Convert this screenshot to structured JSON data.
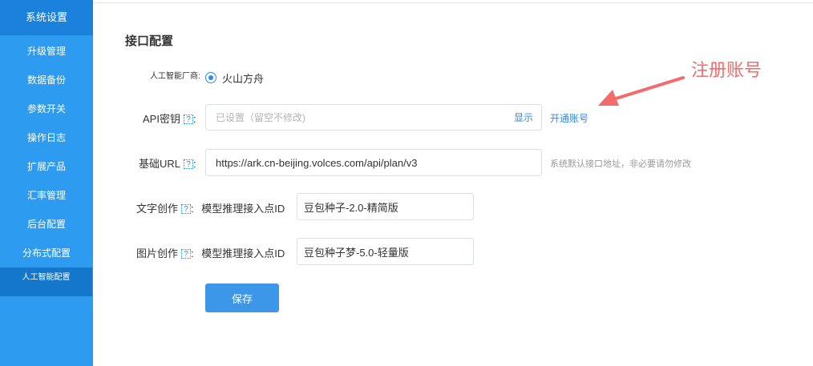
{
  "sidebar": {
    "title": "系统设置",
    "items": [
      {
        "label": "升级管理"
      },
      {
        "label": "数据备份"
      },
      {
        "label": "参数开关"
      },
      {
        "label": "操作日志"
      },
      {
        "label": "扩展产品"
      },
      {
        "label": "汇率管理"
      },
      {
        "label": "后台配置"
      },
      {
        "label": "分布式配置"
      }
    ],
    "sub_item": {
      "label": "人工智能配置"
    }
  },
  "main": {
    "title": "接口配置",
    "vendor": {
      "label": "人工智能厂商:",
      "option": "火山方舟",
      "selected": true
    },
    "api_key": {
      "label": "API密钥",
      "help": "?",
      "colon": ":",
      "placeholder": "已设置（留空不修改)",
      "show": "显示",
      "register_link": "开通账号"
    },
    "base_url": {
      "label": "基础URL",
      "help": "?",
      "colon": ":",
      "value": "https://ark.cn-beijing.volces.com/api/plan/v3",
      "hint": "系统默认接口地址，非必要请勿修改"
    },
    "text_creation": {
      "label": "文字创作",
      "help": "?",
      "colon": ":",
      "endpoint_label": "模型推理接入点ID",
      "value": "豆包种子-2.0-精简版"
    },
    "image_creation": {
      "label": "图片创作",
      "help": "?",
      "colon": ":",
      "endpoint_label": "模型推理接入点ID",
      "value": "豆包种子梦-5.0-轻量版"
    },
    "save_label": "保存"
  },
  "annotation": {
    "text": "注册账号",
    "color": "#f26c6c"
  },
  "colors": {
    "sidebar": "#2d9bf0",
    "sidebar_title": "#1a82dc",
    "sidebar_active": "#1577cc",
    "accent": "#2e8ae6",
    "button": "#3d97e8"
  }
}
